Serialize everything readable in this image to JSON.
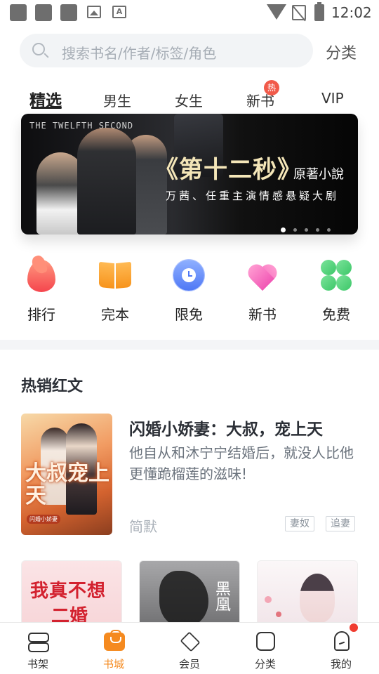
{
  "status_bar": {
    "time": "12:02",
    "app_badge_letter": "A"
  },
  "search": {
    "placeholder": "搜索书名/作者/标签/角色"
  },
  "header": {
    "category_label": "分类"
  },
  "tabs": [
    {
      "label": "精选",
      "active": true
    },
    {
      "label": "男生",
      "active": false
    },
    {
      "label": "女生",
      "active": false
    },
    {
      "label": "新书",
      "active": false,
      "badge": "热"
    },
    {
      "label": "VIP",
      "active": false
    }
  ],
  "banner": {
    "header_text": "THE TWELFTH SECOND",
    "title": "《第十二秒》",
    "subtitle": "原著小說",
    "tagline": "万茜、任重主演情感悬疑大剧",
    "page_count": 5,
    "current_page": 1
  },
  "quick_entries": [
    {
      "label": "排行",
      "icon": "flame-icon",
      "color": "#f5454d"
    },
    {
      "label": "完本",
      "icon": "open-book-icon",
      "color": "#f7941d"
    },
    {
      "label": "限免",
      "icon": "clock-icon",
      "color": "#4f78f5"
    },
    {
      "label": "新书",
      "icon": "heart-icon",
      "color": "#f157b5"
    },
    {
      "label": "免费",
      "icon": "clover-icon",
      "color": "#3cc768"
    }
  ],
  "hot_section": {
    "title": "热销红文",
    "featured_book": {
      "title": "闪婚小娇妻：大叔，宠上天",
      "description": "他自从和沐宁宁结婚后，就没人比他更懂跪榴莲的滋味!",
      "author": "简默",
      "tags": [
        "妻奴",
        "追妻"
      ],
      "cover_text": "大叔宠上天",
      "cover_small_text": "闪婚小娇妻"
    },
    "more_books": [
      {
        "cover_text_line1": "我真不想",
        "cover_text_line2": "二婚"
      },
      {
        "cover_text": "黑凰"
      },
      {
        "cover_text": ""
      }
    ]
  },
  "bottom_nav": [
    {
      "label": "书架",
      "icon": "bookshelf-icon",
      "active": false
    },
    {
      "label": "书城",
      "icon": "bookstore-icon",
      "active": true
    },
    {
      "label": "会员",
      "icon": "diamond-icon",
      "active": false
    },
    {
      "label": "分类",
      "icon": "category-icon",
      "active": false
    },
    {
      "label": "我的",
      "icon": "profile-icon",
      "active": false,
      "has_dot": true
    }
  ],
  "colors": {
    "accent": "#f58a1f",
    "badge_red": "#f15a4a"
  }
}
